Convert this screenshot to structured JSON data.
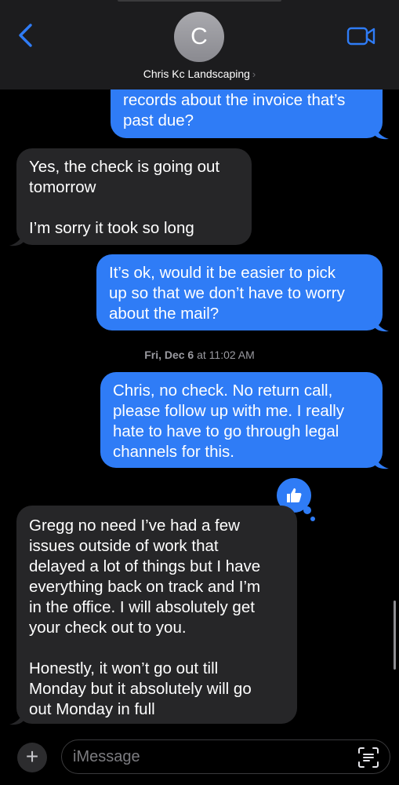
{
  "header": {
    "avatar_initial": "C",
    "contact_name": "Chris Kc Landscaping",
    "contact_chevron": "›",
    "back_icon": "chevron-left",
    "video_icon": "video-camera"
  },
  "thread": {
    "messages": [
      {
        "direction": "outgoing",
        "text": "records about the invoice that’s\npast due?"
      },
      {
        "direction": "incoming",
        "text": "Yes, the check is going out\ntomorrow\n\nI’m sorry it took so long"
      },
      {
        "direction": "outgoing",
        "text": "It’s ok, would it be easier to pick\nup so that we don’t have to worry\nabout the mail?"
      },
      {
        "direction": "outgoing",
        "text": "Chris, no check.  No return call,\nplease follow up with me.  I really\nhate to have to go through legal\nchannels for this."
      },
      {
        "direction": "incoming",
        "text": "Gregg no need I’ve had a few\nissues outside of work that\ndelayed a lot of things but I have\neverything back on track and I’m\nin the office. I will absolutely get\nyour check out to you.\n\nHonestly, it won’t go out till\nMonday but it absolutely will go\nout Monday in full"
      }
    ],
    "timestamp_day": "Fri, Dec 6",
    "timestamp_time": "at 11:02 AM",
    "tapback_icon": "thumbs-up"
  },
  "composer": {
    "plus_label": "+",
    "placeholder": "iMessage",
    "value": ""
  },
  "colors": {
    "outgoing_bubble": "#2f7cf6",
    "incoming_bubble": "#262628",
    "accent": "#2f7cf6",
    "background": "#000000"
  }
}
